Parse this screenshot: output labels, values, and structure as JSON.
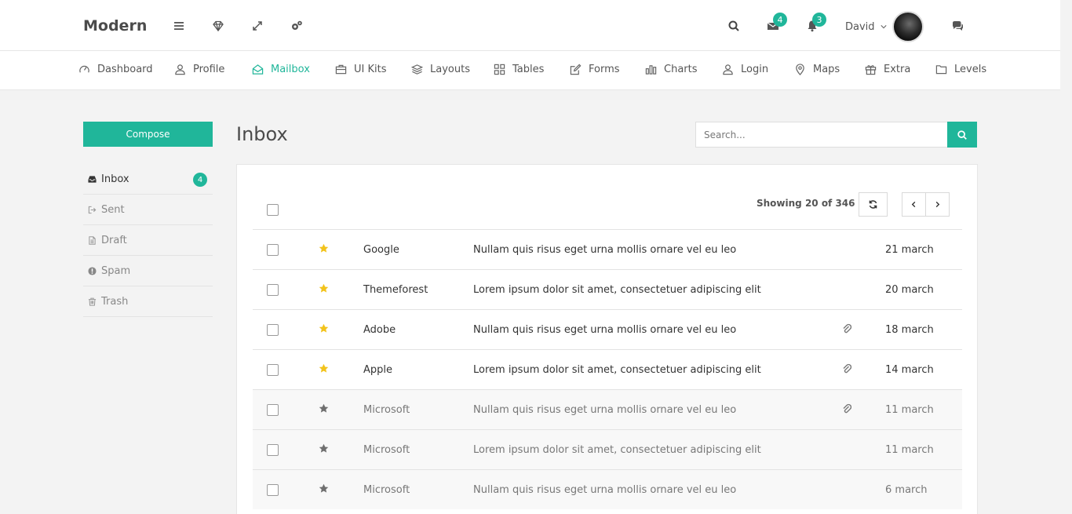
{
  "app": {
    "brand": "Modern",
    "accent": "#20b69a"
  },
  "header": {
    "icons": [
      "menu-icon",
      "diamond-icon",
      "expand-icon",
      "settings-icon",
      "search-icon",
      "envelope-icon",
      "bell-icon",
      "chat-icon"
    ],
    "mail_count": "4",
    "notification_count": "3",
    "user_name": "David"
  },
  "nav": {
    "items": [
      {
        "label": "Dashboard",
        "icon": "dashboard-icon"
      },
      {
        "label": "Profile",
        "icon": "user-icon"
      },
      {
        "label": "Mailbox",
        "icon": "mailbox-icon",
        "active": true
      },
      {
        "label": "UI Kits",
        "icon": "briefcase-icon"
      },
      {
        "label": "Layouts",
        "icon": "layers-icon"
      },
      {
        "label": "Tables",
        "icon": "grid-icon"
      },
      {
        "label": "Forms",
        "icon": "edit-icon"
      },
      {
        "label": "Charts",
        "icon": "bar-chart-icon"
      },
      {
        "label": "Login",
        "icon": "user-icon"
      },
      {
        "label": "Maps",
        "icon": "map-pin-icon"
      },
      {
        "label": "Extra",
        "icon": "gift-icon"
      },
      {
        "label": "Levels",
        "icon": "folder-icon"
      }
    ]
  },
  "sidebar": {
    "compose_label": "Compose",
    "folders": [
      {
        "label": "Inbox",
        "icon": "inbox-icon",
        "count": "4",
        "active": true
      },
      {
        "label": "Sent",
        "icon": "sign-out-icon"
      },
      {
        "label": "Draft",
        "icon": "file-icon"
      },
      {
        "label": "Spam",
        "icon": "exclamation-circle-icon"
      },
      {
        "label": "Trash",
        "icon": "trash-icon"
      }
    ]
  },
  "main": {
    "title": "Inbox",
    "search_placeholder": "Search...",
    "showing_text": "Showing 20 of 346",
    "emails": [
      {
        "from": "Google",
        "subject": "Nullam quis risus eget urna mollis ornare vel eu leo",
        "date": "21 march",
        "starred": true,
        "attachment": false,
        "read": false
      },
      {
        "from": "Themeforest",
        "subject": "Lorem ipsum dolor sit amet, consectetuer adipiscing elit",
        "date": "20 march",
        "starred": true,
        "attachment": false,
        "read": false
      },
      {
        "from": "Adobe",
        "subject": "Nullam quis risus eget urna mollis ornare vel eu leo",
        "date": "18 march",
        "starred": true,
        "attachment": true,
        "read": false
      },
      {
        "from": "Apple",
        "subject": "Lorem ipsum dolor sit amet, consectetuer adipiscing elit",
        "date": "14 march",
        "starred": true,
        "attachment": true,
        "read": false
      },
      {
        "from": "Microsoft",
        "subject": "Nullam quis risus eget urna mollis ornare vel eu leo",
        "date": "11 march",
        "starred": false,
        "attachment": true,
        "read": true
      },
      {
        "from": "Microsoft",
        "subject": "Lorem ipsum dolor sit amet, consectetuer adipiscing elit",
        "date": "11 march",
        "starred": false,
        "attachment": false,
        "read": true
      },
      {
        "from": "Microsoft",
        "subject": "Nullam quis risus eget urna mollis ornare vel eu leo",
        "date": "6 march",
        "starred": false,
        "attachment": false,
        "read": true
      }
    ]
  },
  "colors": {
    "star_active": "#f2c31c",
    "star_inactive": "#6f6f6f"
  }
}
